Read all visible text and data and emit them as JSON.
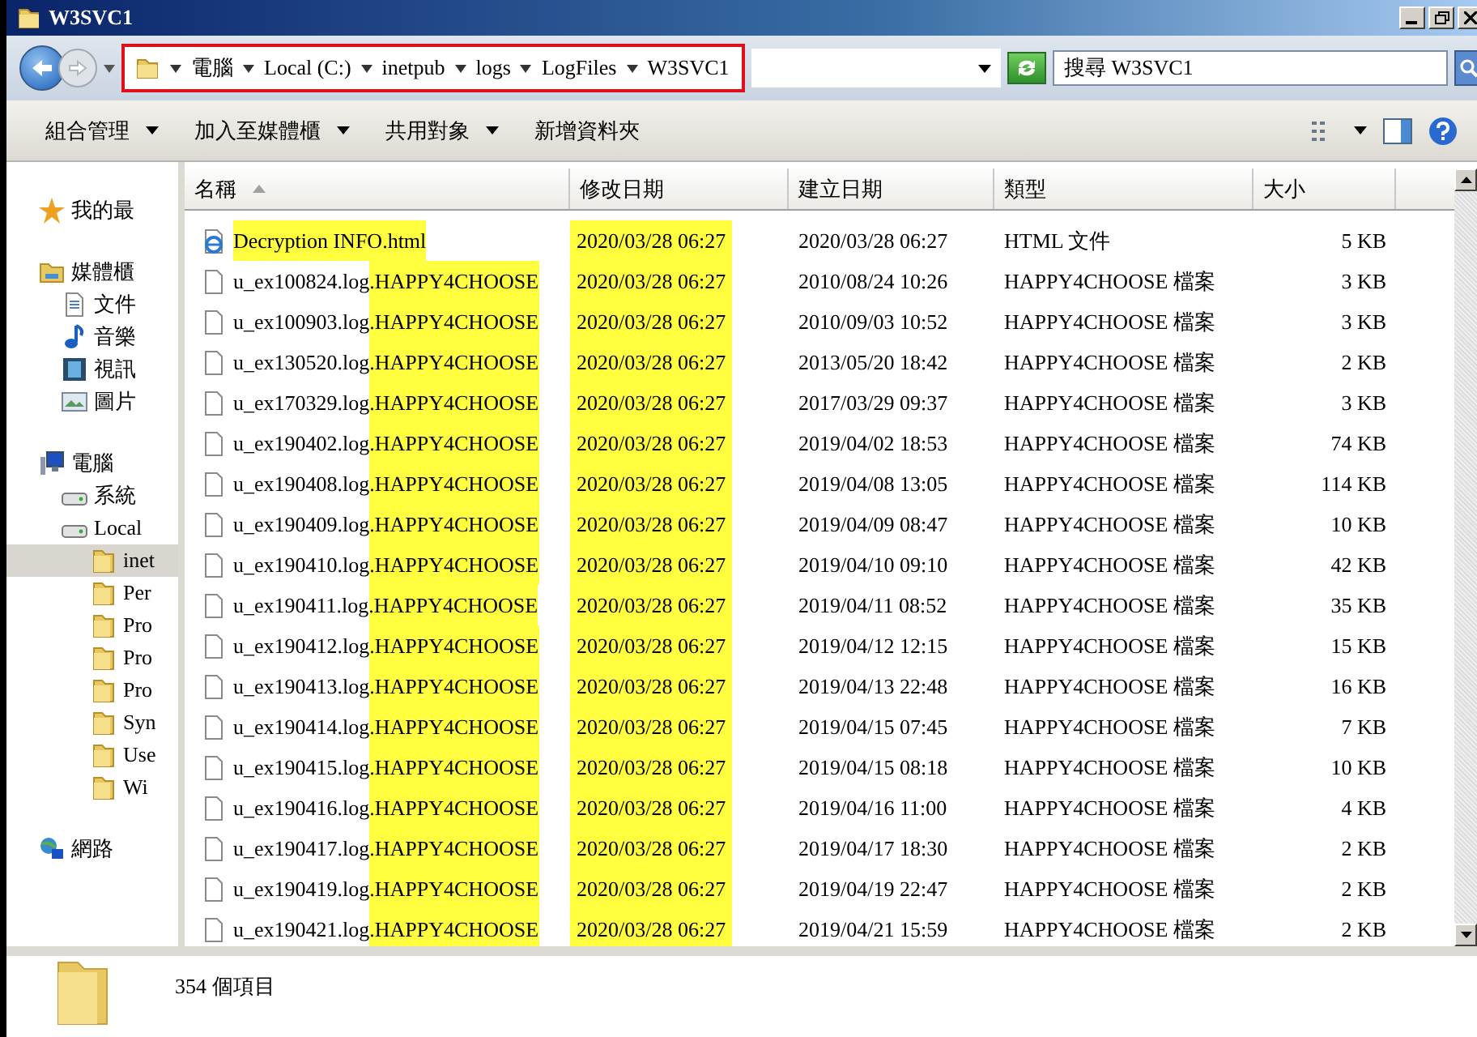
{
  "window": {
    "title": "W3SVC1"
  },
  "address": {
    "highlighted": true,
    "crumbs": [
      "電腦",
      "Local (C:)",
      "inetpub",
      "logs",
      "LogFiles",
      "W3SVC1"
    ]
  },
  "search": {
    "placeholder": "搜尋 W3SVC1"
  },
  "toolbar": {
    "buttons": [
      {
        "label": "組合管理",
        "menu": true
      },
      {
        "label": "加入至媒體櫃",
        "menu": true
      },
      {
        "label": "共用對象",
        "menu": true
      },
      {
        "label": "新增資料夾",
        "menu": false
      }
    ]
  },
  "sidebar": {
    "items": [
      {
        "kind": "favorites",
        "label": "我的最",
        "selected": false
      },
      {
        "kind": "library",
        "label": "媒體櫃",
        "selected": false,
        "children": [
          {
            "kind": "documents",
            "label": "文件",
            "selected": false
          },
          {
            "kind": "music",
            "label": "音樂",
            "selected": false
          },
          {
            "kind": "video",
            "label": "視訊",
            "selected": false
          },
          {
            "kind": "pictures",
            "label": "圖片",
            "selected": false
          }
        ]
      },
      {
        "kind": "computer",
        "label": "電腦",
        "selected": false,
        "children": [
          {
            "kind": "drive",
            "label": "系統",
            "selected": false
          },
          {
            "kind": "drive",
            "label": "Local",
            "selected": false,
            "children": [
              {
                "kind": "folder",
                "label": "inet",
                "selected": true
              },
              {
                "kind": "folder",
                "label": "Per",
                "selected": false
              },
              {
                "kind": "folder",
                "label": "Pro",
                "selected": false
              },
              {
                "kind": "folder",
                "label": "Pro",
                "selected": false
              },
              {
                "kind": "folder",
                "label": "Pro",
                "selected": false
              },
              {
                "kind": "folder",
                "label": "Syn",
                "selected": false
              },
              {
                "kind": "folder",
                "label": "Use",
                "selected": false
              },
              {
                "kind": "folder",
                "label": "Wi",
                "selected": false
              }
            ]
          }
        ]
      },
      {
        "kind": "network",
        "label": "網路",
        "selected": false
      }
    ]
  },
  "table": {
    "columns": [
      {
        "label": "名稱",
        "sorted": true
      },
      {
        "label": "修改日期",
        "sorted": false
      },
      {
        "label": "建立日期",
        "sorted": false
      },
      {
        "label": "類型",
        "sorted": false
      },
      {
        "label": "大小",
        "sorted": false
      }
    ],
    "rows": [
      {
        "kind": "html",
        "name": [
          {
            "text": "Decryption INFO.html",
            "highlighted": true
          }
        ],
        "modified": {
          "text": "2020/03/28 06:27",
          "highlighted": true
        },
        "created": "2020/03/28 06:27",
        "type": "HTML 文件",
        "size": "5 KB"
      },
      {
        "kind": "file",
        "name": [
          {
            "text": "u_ex100824.log",
            "highlighted": false
          },
          {
            "text": ".HAPPY4CHOOSE",
            "highlighted": true
          }
        ],
        "modified": {
          "text": "2020/03/28 06:27",
          "highlighted": true
        },
        "created": "2010/08/24 10:26",
        "type": "HAPPY4CHOOSE 檔案",
        "size": "3 KB"
      },
      {
        "kind": "file",
        "name": [
          {
            "text": "u_ex100903.log",
            "highlighted": false
          },
          {
            "text": ".HAPPY4CHOOSE",
            "highlighted": true
          }
        ],
        "modified": {
          "text": "2020/03/28 06:27",
          "highlighted": true
        },
        "created": "2010/09/03 10:52",
        "type": "HAPPY4CHOOSE 檔案",
        "size": "3 KB"
      },
      {
        "kind": "file",
        "name": [
          {
            "text": "u_ex130520.log",
            "highlighted": false
          },
          {
            "text": ".HAPPY4CHOOSE",
            "highlighted": true
          }
        ],
        "modified": {
          "text": "2020/03/28 06:27",
          "highlighted": true
        },
        "created": "2013/05/20 18:42",
        "type": "HAPPY4CHOOSE 檔案",
        "size": "2 KB"
      },
      {
        "kind": "file",
        "name": [
          {
            "text": "u_ex170329.log",
            "highlighted": false
          },
          {
            "text": ".HAPPY4CHOOSE",
            "highlighted": true
          }
        ],
        "modified": {
          "text": "2020/03/28 06:27",
          "highlighted": true
        },
        "created": "2017/03/29 09:37",
        "type": "HAPPY4CHOOSE 檔案",
        "size": "3 KB"
      },
      {
        "kind": "file",
        "name": [
          {
            "text": "u_ex190402.log",
            "highlighted": false
          },
          {
            "text": ".HAPPY4CHOOSE",
            "highlighted": true
          }
        ],
        "modified": {
          "text": "2020/03/28 06:27",
          "highlighted": true
        },
        "created": "2019/04/02 18:53",
        "type": "HAPPY4CHOOSE 檔案",
        "size": "74 KB"
      },
      {
        "kind": "file",
        "name": [
          {
            "text": "u_ex190408.log",
            "highlighted": false
          },
          {
            "text": ".HAPPY4CHOOSE",
            "highlighted": true
          }
        ],
        "modified": {
          "text": "2020/03/28 06:27",
          "highlighted": true
        },
        "created": "2019/04/08 13:05",
        "type": "HAPPY4CHOOSE 檔案",
        "size": "114 KB"
      },
      {
        "kind": "file",
        "name": [
          {
            "text": "u_ex190409.log",
            "highlighted": false
          },
          {
            "text": ".HAPPY4CHOOSE",
            "highlighted": true
          }
        ],
        "modified": {
          "text": "2020/03/28 06:27",
          "highlighted": true
        },
        "created": "2019/04/09 08:47",
        "type": "HAPPY4CHOOSE 檔案",
        "size": "10 KB"
      },
      {
        "kind": "file",
        "name": [
          {
            "text": "u_ex190410.log",
            "highlighted": false
          },
          {
            "text": ".HAPPY4CHOOSE",
            "highlighted": true
          }
        ],
        "modified": {
          "text": "2020/03/28 06:27",
          "highlighted": true
        },
        "created": "2019/04/10 09:10",
        "type": "HAPPY4CHOOSE 檔案",
        "size": "42 KB"
      },
      {
        "kind": "file",
        "name": [
          {
            "text": "u_ex190411.log",
            "highlighted": false
          },
          {
            "text": ".HAPPY4CHOOSE",
            "highlighted": true
          }
        ],
        "modified": {
          "text": "2020/03/28 06:27",
          "highlighted": true
        },
        "created": "2019/04/11 08:52",
        "type": "HAPPY4CHOOSE 檔案",
        "size": "35 KB"
      },
      {
        "kind": "file",
        "name": [
          {
            "text": "u_ex190412.log",
            "highlighted": false
          },
          {
            "text": ".HAPPY4CHOOSE",
            "highlighted": true
          }
        ],
        "modified": {
          "text": "2020/03/28 06:27",
          "highlighted": true
        },
        "created": "2019/04/12 12:15",
        "type": "HAPPY4CHOOSE 檔案",
        "size": "15 KB"
      },
      {
        "kind": "file",
        "name": [
          {
            "text": "u_ex190413.log",
            "highlighted": false
          },
          {
            "text": ".HAPPY4CHOOSE",
            "highlighted": true
          }
        ],
        "modified": {
          "text": "2020/03/28 06:27",
          "highlighted": true
        },
        "created": "2019/04/13 22:48",
        "type": "HAPPY4CHOOSE 檔案",
        "size": "16 KB"
      },
      {
        "kind": "file",
        "name": [
          {
            "text": "u_ex190414.log",
            "highlighted": false
          },
          {
            "text": ".HAPPY4CHOOSE",
            "highlighted": true
          }
        ],
        "modified": {
          "text": "2020/03/28 06:27",
          "highlighted": true
        },
        "created": "2019/04/15 07:45",
        "type": "HAPPY4CHOOSE 檔案",
        "size": "7 KB"
      },
      {
        "kind": "file",
        "name": [
          {
            "text": "u_ex190415.log",
            "highlighted": false
          },
          {
            "text": ".HAPPY4CHOOSE",
            "highlighted": true
          }
        ],
        "modified": {
          "text": "2020/03/28 06:27",
          "highlighted": true
        },
        "created": "2019/04/15 08:18",
        "type": "HAPPY4CHOOSE 檔案",
        "size": "10 KB"
      },
      {
        "kind": "file",
        "name": [
          {
            "text": "u_ex190416.log",
            "highlighted": false
          },
          {
            "text": ".HAPPY4CHOOSE",
            "highlighted": true
          }
        ],
        "modified": {
          "text": "2020/03/28 06:27",
          "highlighted": true
        },
        "created": "2019/04/16 11:00",
        "type": "HAPPY4CHOOSE 檔案",
        "size": "4 KB"
      },
      {
        "kind": "file",
        "name": [
          {
            "text": "u_ex190417.log",
            "highlighted": false
          },
          {
            "text": ".HAPPY4CHOOSE",
            "highlighted": true
          }
        ],
        "modified": {
          "text": "2020/03/28 06:27",
          "highlighted": true
        },
        "created": "2019/04/17 18:30",
        "type": "HAPPY4CHOOSE 檔案",
        "size": "2 KB"
      },
      {
        "kind": "file",
        "name": [
          {
            "text": "u_ex190419.log",
            "highlighted": false
          },
          {
            "text": ".HAPPY4CHOOSE",
            "highlighted": true
          }
        ],
        "modified": {
          "text": "2020/03/28 06:27",
          "highlighted": true
        },
        "created": "2019/04/19 22:47",
        "type": "HAPPY4CHOOSE 檔案",
        "size": "2 KB"
      },
      {
        "kind": "file",
        "name": [
          {
            "text": "u_ex190421.log",
            "highlighted": false
          },
          {
            "text": ".HAPPY4CHOOSE",
            "highlighted": true
          }
        ],
        "modified": {
          "text": "2020/03/28 06:27",
          "highlighted": true
        },
        "created": "2019/04/21 15:59",
        "type": "HAPPY4CHOOSE 檔案",
        "size": "2 KB"
      }
    ]
  },
  "status_bar": {
    "count": "354 個項目"
  }
}
